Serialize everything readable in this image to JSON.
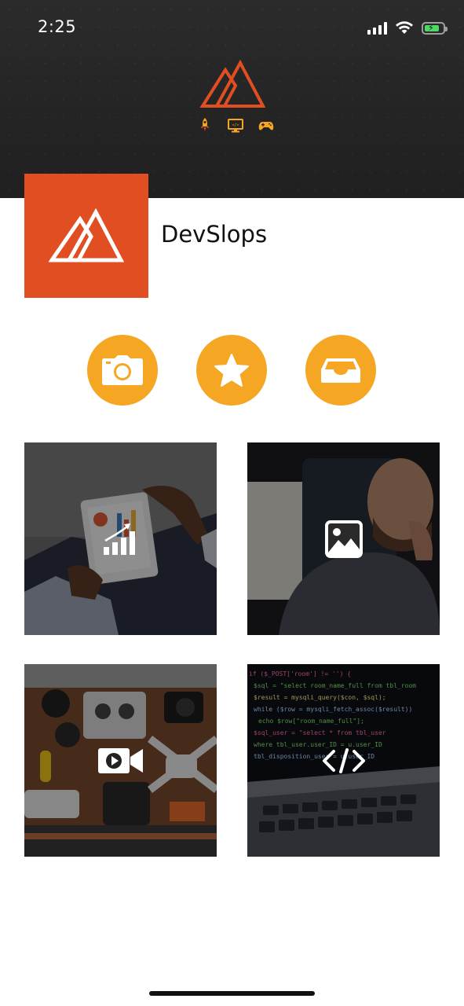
{
  "status_bar": {
    "time": "2:25"
  },
  "header": {
    "logo_icon": "mountain-logo-icon",
    "icons": [
      "rocket-icon",
      "monitor-code-icon",
      "gamepad-icon"
    ]
  },
  "profile": {
    "name": "DevSlops",
    "logo_color": "#e04e21"
  },
  "actions": [
    {
      "icon": "camera-icon"
    },
    {
      "icon": "star-icon"
    },
    {
      "icon": "inbox-icon"
    }
  ],
  "tiles": [
    {
      "icon": "chart-icon"
    },
    {
      "icon": "image-icon"
    },
    {
      "icon": "video-icon"
    },
    {
      "icon": "code-icon"
    }
  ],
  "colors": {
    "accent": "#f5a623",
    "brand": "#e04e21",
    "header_bg": "#252525"
  }
}
